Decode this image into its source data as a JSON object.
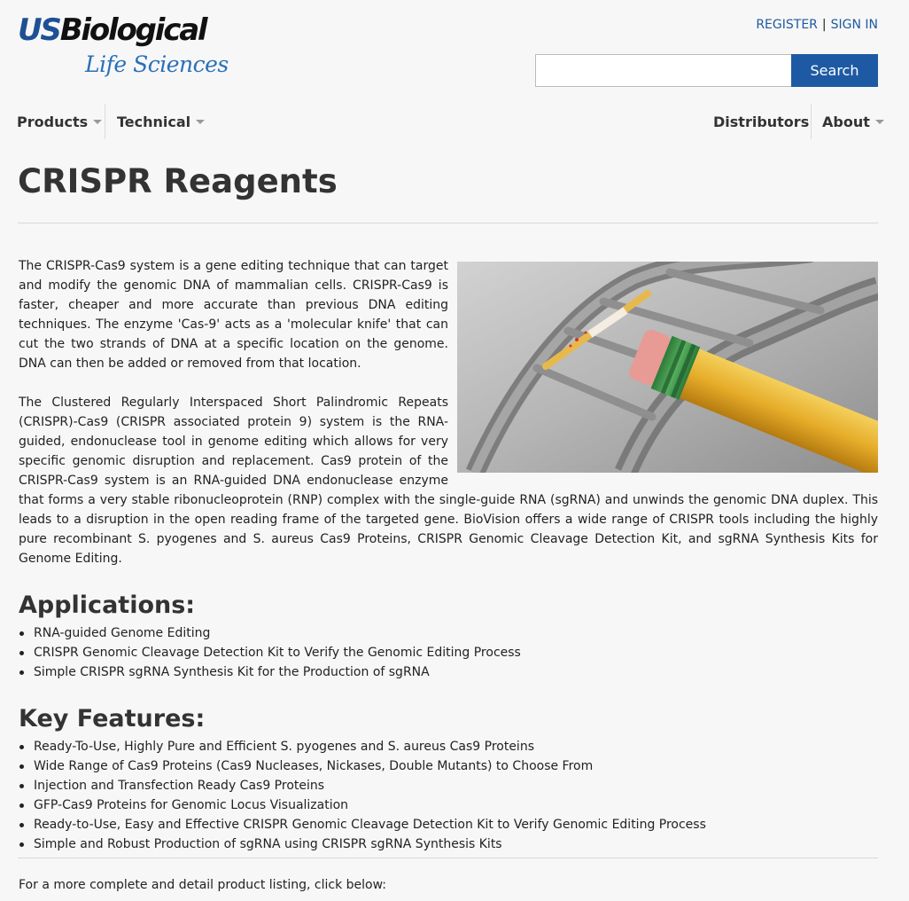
{
  "brand": {
    "logo_us": "US",
    "logo_bio": "Biological",
    "logo_sub": "Life Sciences",
    "accent": "#1d5aa3"
  },
  "header": {
    "register_label": "REGISTER",
    "separator": "|",
    "signin_label": "SIGN IN",
    "search_placeholder": "",
    "search_button": "Search"
  },
  "nav": {
    "products": "Products",
    "technical": "Technical",
    "distributors": "Distributors",
    "about": "About"
  },
  "page": {
    "title": "CRISPR Reagents",
    "intro_paragraph": "The CRISPR-Cas9 system is a gene editing technique that can target and modify the genomic DNA of mammalian cells. CRISPR-Cas9 is faster, cheaper and more accurate than previous DNA editing techniques. The enzyme 'Cas-9' acts as a 'molecular knife' that can cut the two strands of DNA at a specific location on the genome. DNA can then be added or removed from that location.",
    "second_paragraph": "The Clustered Regularly Interspaced Short Palindromic Repeats (CRISPR)-Cas9 (CRISPR associated protein 9) system is the RNA-guided, endonuclease tool in genome editing which allows for very specific genomic disruption and replacement. Cas9 protein of the CRISPR-Cas9 system is an RNA-guided DNA endonuclease enzyme that forms a very stable ribonucleoprotein (RNP) complex with the single-guide RNA (sgRNA) and unwinds the genomic DNA duplex. This leads to a disruption in the open reading frame of the targeted gene. BioVision offers a wide range of CRISPR tools including the highly pure recombinant S. pyogenes and S. aureus Cas9 Proteins, CRISPR Genomic Cleavage Detection Kit, and sgRNA Synthesis Kits for Genome Editing.",
    "applications_heading": "Applications:",
    "applications": [
      "RNA-guided Genome Editing",
      "CRISPR Genomic Cleavage Detection Kit to Verify the Genomic Editing Process",
      "Simple CRISPR sgRNA Synthesis Kit for the Production of sgRNA"
    ],
    "features_heading": "Key Features:",
    "features": [
      "Ready-To-Use, Highly Pure and Efficient S. pyogenes and S. aureus Cas9 Proteins",
      "Wide Range of Cas9 Proteins (Cas9 Nucleases, Nickases, Double Mutants) to Choose From",
      "Injection and Transfection Ready Cas9 Proteins",
      "GFP-Cas9 Proteins for Genomic Locus Visualization",
      "Ready-to-Use, Easy and Effective CRISPR Genomic Cleavage Detection Kit to Verify Genomic Editing Process",
      "Simple and Robust Production of sgRNA using CRISPR sgRNA Synthesis Kits"
    ],
    "listing_text": "For a more complete and detail product listing, click below:"
  }
}
